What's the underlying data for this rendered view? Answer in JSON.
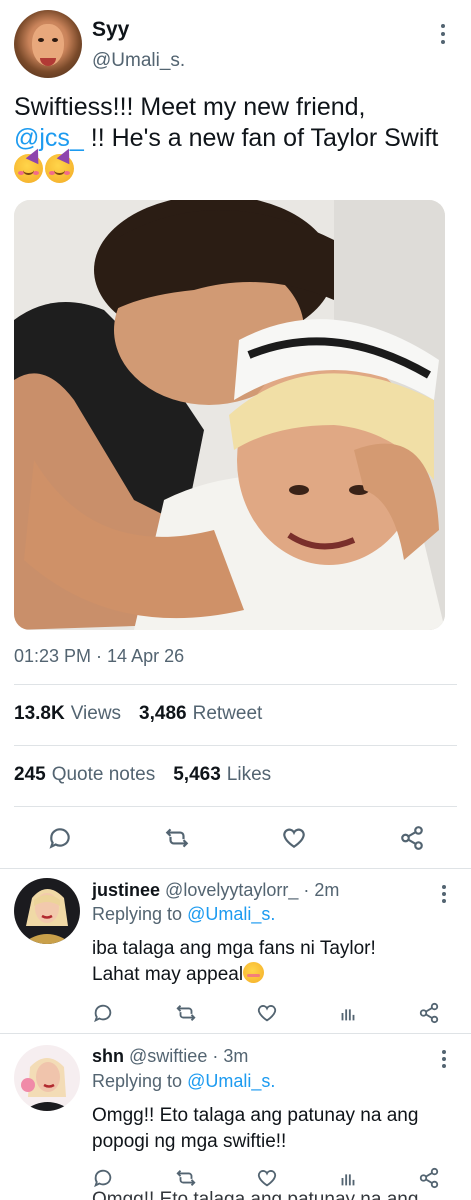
{
  "tweet": {
    "author_name": "Syy",
    "author_handle": "@Umali_s.",
    "text_before_mention": "Swiftiess!!! Meet my new friend,",
    "mention": "@jcs_",
    "text_after_mention": " !! He's a new fan of Taylor Swift",
    "emojis": [
      "partying-face",
      "partying-face"
    ],
    "timestamp": "01:23 PM · 14 Apr 26",
    "views_count": "13.8K",
    "views_label": "Views",
    "retweet_count": "3,486",
    "retweet_label": "Retweet",
    "quote_count": "245",
    "quote_label": "Quote notes",
    "likes_count": "5,463",
    "likes_label": "Likes",
    "actions": [
      "reply-icon",
      "retweet-icon",
      "heart-icon",
      "share-icon"
    ]
  },
  "replies": [
    {
      "name": "justinee",
      "handle": "@lovelyytaylorr_",
      "time": "· 2m",
      "replying_prefix": "Replying to",
      "replying_to": "@Umali_s.",
      "text_line1": "iba talaga ang mga fans ni Taylor!",
      "text_line2": "Lahat may appeal",
      "emoji": "smiling-face-with-closed-eyes",
      "actions": [
        "reply-icon",
        "retweet-icon",
        "heart-icon",
        "analytics-icon",
        "share-icon"
      ]
    },
    {
      "name": "shn",
      "handle": "@swiftiee",
      "time": "· 3m",
      "replying_prefix": "Replying to",
      "replying_to": "@Umali_s.",
      "text_line1": "Omgg!! Eto talaga ang patunay na ang",
      "text_line2": "popogi ng mga swiftie!!",
      "actions": [
        "reply-icon",
        "retweet-icon",
        "heart-icon",
        "analytics-icon",
        "share-icon"
      ]
    }
  ],
  "cutoff_text": "Omgg!! Eto talaga ang patunay na ang",
  "colors": {
    "text": "#0f1419",
    "secondary": "#536471",
    "link": "#1d9bf0",
    "divider": "#dfe3e6"
  }
}
